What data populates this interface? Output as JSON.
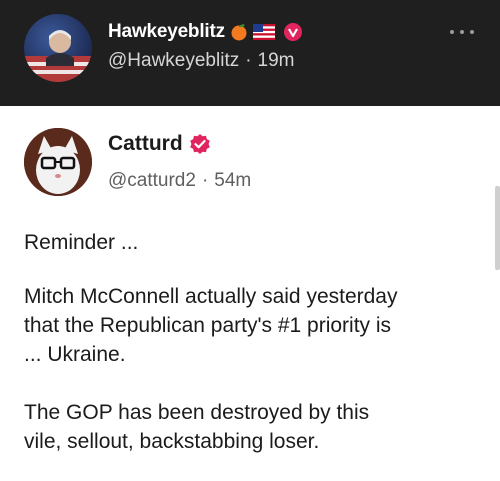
{
  "repost": {
    "display_name": "Hawkeyeblitz",
    "handle": "@Hawkeyeblitz",
    "separator": "·",
    "time": "19m",
    "name_emojis": [
      "peach",
      "us-flag",
      "red-verified"
    ]
  },
  "quoted": {
    "display_name": "Catturd",
    "handle": "@catturd2",
    "separator": "·",
    "time": "54m",
    "verified_color": "#e0245e",
    "paragraphs": [
      "Reminder ...",
      "Mitch McConnell actually said yesterday\nthat the Republican party's #1 priority is\n... Ukraine.",
      "The GOP has been destroyed by this\nvile, sellout, backstabbing loser."
    ]
  },
  "colors": {
    "header_bg": "#1f1f1f",
    "text_primary": "#1b1b1b",
    "text_secondary": "#5f5f5f"
  }
}
